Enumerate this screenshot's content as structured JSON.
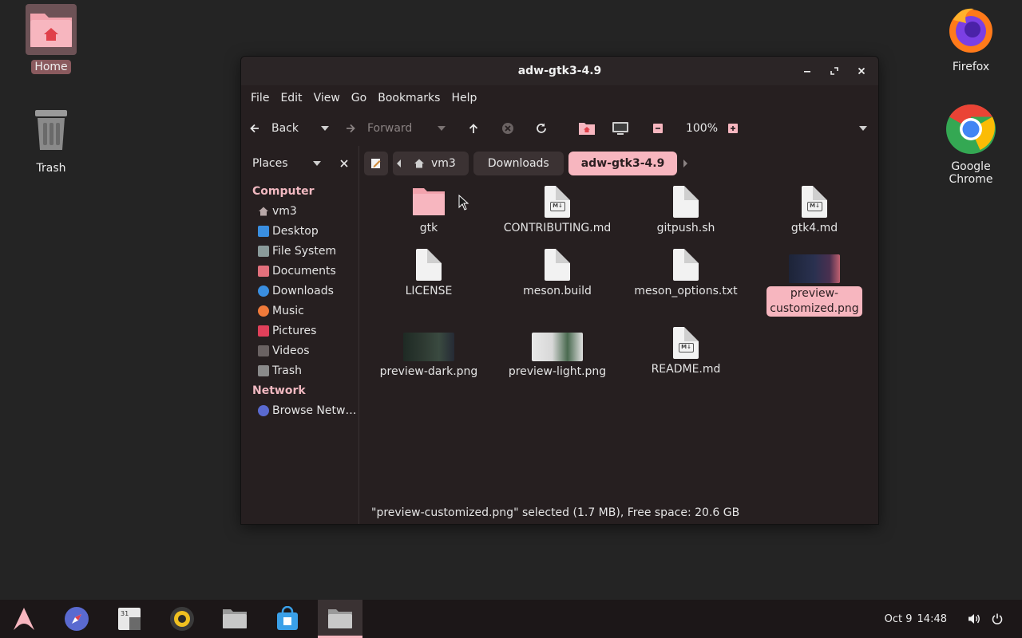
{
  "desktop": {
    "icons": [
      {
        "label": "Home",
        "icon": "home-folder-icon"
      },
      {
        "label": "Trash",
        "icon": "trash-icon"
      },
      {
        "label": "Firefox",
        "icon": "firefox-icon"
      },
      {
        "label": "Google Chrome",
        "icon": "chrome-icon"
      }
    ]
  },
  "window": {
    "title": "adw-gtk3-4.9",
    "menu": [
      "File",
      "Edit",
      "View",
      "Go",
      "Bookmarks",
      "Help"
    ],
    "toolbar": {
      "back_label": "Back",
      "forward_label": "Forward",
      "zoom": "100%"
    },
    "pathbar": {
      "places_label": "Places",
      "crumbs": [
        "vm3",
        "Downloads",
        "adw-gtk3-4.9"
      ]
    },
    "sidebar": {
      "sections": [
        {
          "heading": "Computer",
          "items": [
            "vm3",
            "Desktop",
            "File System",
            "Documents",
            "Downloads",
            "Music",
            "Pictures",
            "Videos",
            "Trash"
          ]
        },
        {
          "heading": "Network",
          "items": [
            "Browse Netw…"
          ]
        }
      ]
    },
    "files": [
      {
        "name": "gtk",
        "type": "folder"
      },
      {
        "name": "CONTRIBUTING.md",
        "type": "markdown"
      },
      {
        "name": "gitpush.sh",
        "type": "script"
      },
      {
        "name": "gtk4.md",
        "type": "markdown"
      },
      {
        "name": "LICENSE",
        "type": "text"
      },
      {
        "name": "meson.build",
        "type": "text"
      },
      {
        "name": "meson_options.txt",
        "type": "text"
      },
      {
        "name": "preview-customized.png",
        "name_line1": "preview-",
        "name_line2": "customized.png",
        "type": "image",
        "selected": true
      },
      {
        "name": "preview-dark.png",
        "type": "image"
      },
      {
        "name": "preview-light.png",
        "type": "image"
      },
      {
        "name": "README.md",
        "type": "markdown"
      }
    ],
    "status": "\"preview-customized.png\" selected (1.7 MB), Free space: 20.6 GB"
  },
  "taskbar": {
    "date": "Oct 9",
    "time": "14:48"
  },
  "colors": {
    "accent": "#f7b6bf",
    "window_bg": "#261f20",
    "desktop_bg": "#242424"
  }
}
